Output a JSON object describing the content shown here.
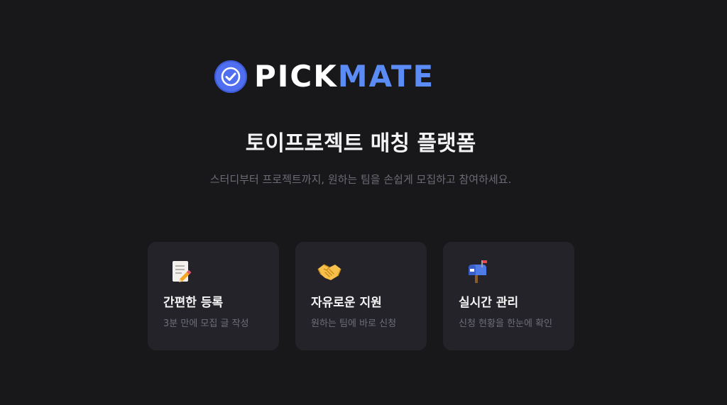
{
  "logo": {
    "part1": "PICK",
    "part2": "MATE",
    "icon": "check-badge-icon"
  },
  "hero": {
    "title": "토이프로젝트 매칭 플랫폼",
    "subtitle": "스터디부터 프로젝트까지, 원하는 팀을 손쉽게 모집하고 참여하세요."
  },
  "features": [
    {
      "icon": "memo-pencil-icon",
      "title": "간편한 등록",
      "desc": "3분 만에 모집 글 작성"
    },
    {
      "icon": "handshake-icon",
      "title": "자유로운 지원",
      "desc": "원하는 팀에 바로 신청"
    },
    {
      "icon": "mailbox-icon",
      "title": "실시간 관리",
      "desc": "신청 현황을 한눈에 확인"
    }
  ],
  "colors": {
    "background": "#18181b",
    "card": "#232329",
    "accent": "#5b8cf5",
    "badge": "#4f6ef0"
  }
}
